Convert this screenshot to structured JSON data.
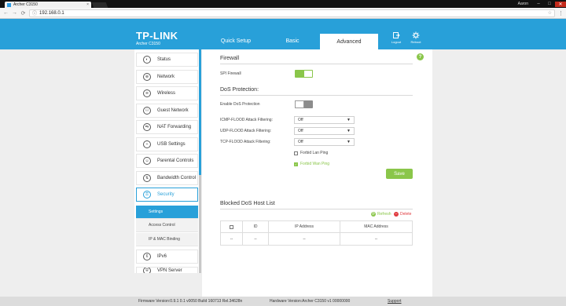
{
  "browser": {
    "tab_title": "Archer C3150",
    "tab_close": "×",
    "user": "Aaron",
    "min": "–",
    "max": "□",
    "close": "✕",
    "back": "←",
    "forward": "→",
    "reload": "⟳",
    "page_icon": "ⓘ",
    "url": "192.168.0.1",
    "star": "☆",
    "menu": "⋮"
  },
  "header": {
    "logo": "TP-LINK",
    "model": "Archer C3150",
    "tabs": [
      {
        "label": "Quick Setup"
      },
      {
        "label": "Basic"
      },
      {
        "label": "Advanced"
      }
    ],
    "logout": "Logout",
    "reboot": "Reboot"
  },
  "sidebar": {
    "items": [
      {
        "label": "Status",
        "icon": "status-icon",
        "glyph": "◐"
      },
      {
        "label": "Network",
        "icon": "network-icon",
        "glyph": "⊕"
      },
      {
        "label": "Wireless",
        "icon": "wireless-icon",
        "glyph": "≋"
      },
      {
        "label": "Guest Network",
        "icon": "guest-network-icon",
        "glyph": "⚇"
      },
      {
        "label": "NAT Forwarding",
        "icon": "nat-forwarding-icon",
        "glyph": "⇆"
      },
      {
        "label": "USB Settings",
        "icon": "usb-icon",
        "glyph": "⌁"
      },
      {
        "label": "Parental Controls",
        "icon": "parental-controls-icon",
        "glyph": "☺"
      },
      {
        "label": "Bandwidth Control",
        "icon": "bandwidth-icon",
        "glyph": "⇅"
      },
      {
        "label": "Security",
        "icon": "security-icon",
        "glyph": "⚿"
      },
      {
        "label": "IPv6",
        "icon": "ipv6-icon",
        "glyph": "6"
      },
      {
        "label": "VPN Server",
        "icon": "vpn-icon",
        "glyph": "⛨"
      }
    ],
    "submenu": [
      {
        "label": "Settings"
      },
      {
        "label": "Access Control"
      },
      {
        "label": "IP & MAC Binding"
      }
    ]
  },
  "firewall": {
    "title": "Firewall",
    "spi_label": "SPI Firewall",
    "spi_state": "on"
  },
  "dos": {
    "title": "DoS Protection:",
    "enable_label": "Enable DoS Protection",
    "enable_state": "off",
    "icmp_label": "ICMP-FLOOD Attack Filtering:",
    "icmp_value": "Off",
    "udp_label": "UDP-FLOOD Attack Filtering:",
    "udp_value": "Off",
    "tcp_label": "TCP-FLOOD Attack Filtering:",
    "tcp_value": "Off",
    "forbid_lan_ping": "Forbid Lan Ping",
    "forbid_wan_ping": "Forbid Wan Ping",
    "save": "Save",
    "select_arrow": "▼",
    "check_mark": "✓"
  },
  "blocked": {
    "title": "Blocked DoS Host List",
    "refresh": "Refresh",
    "delete": "Delete",
    "refresh_glyph": "⟳",
    "delete_glyph": "–",
    "columns": [
      "ID",
      "IP Address",
      "MAC Address"
    ],
    "row": [
      "--",
      "--",
      "--",
      "--"
    ]
  },
  "help": "?",
  "footer": {
    "firmware": "Firmware Version:0.9.1 0.1 v0050 Build 160713 Rel.34628n",
    "hardware": "Hardware Version:Archer C3150 v1 00000000",
    "support": "Support"
  },
  "colors": {
    "header_blue": "#28a0d9",
    "accent_green": "#8ac64a",
    "delete_red": "#e0393e"
  }
}
